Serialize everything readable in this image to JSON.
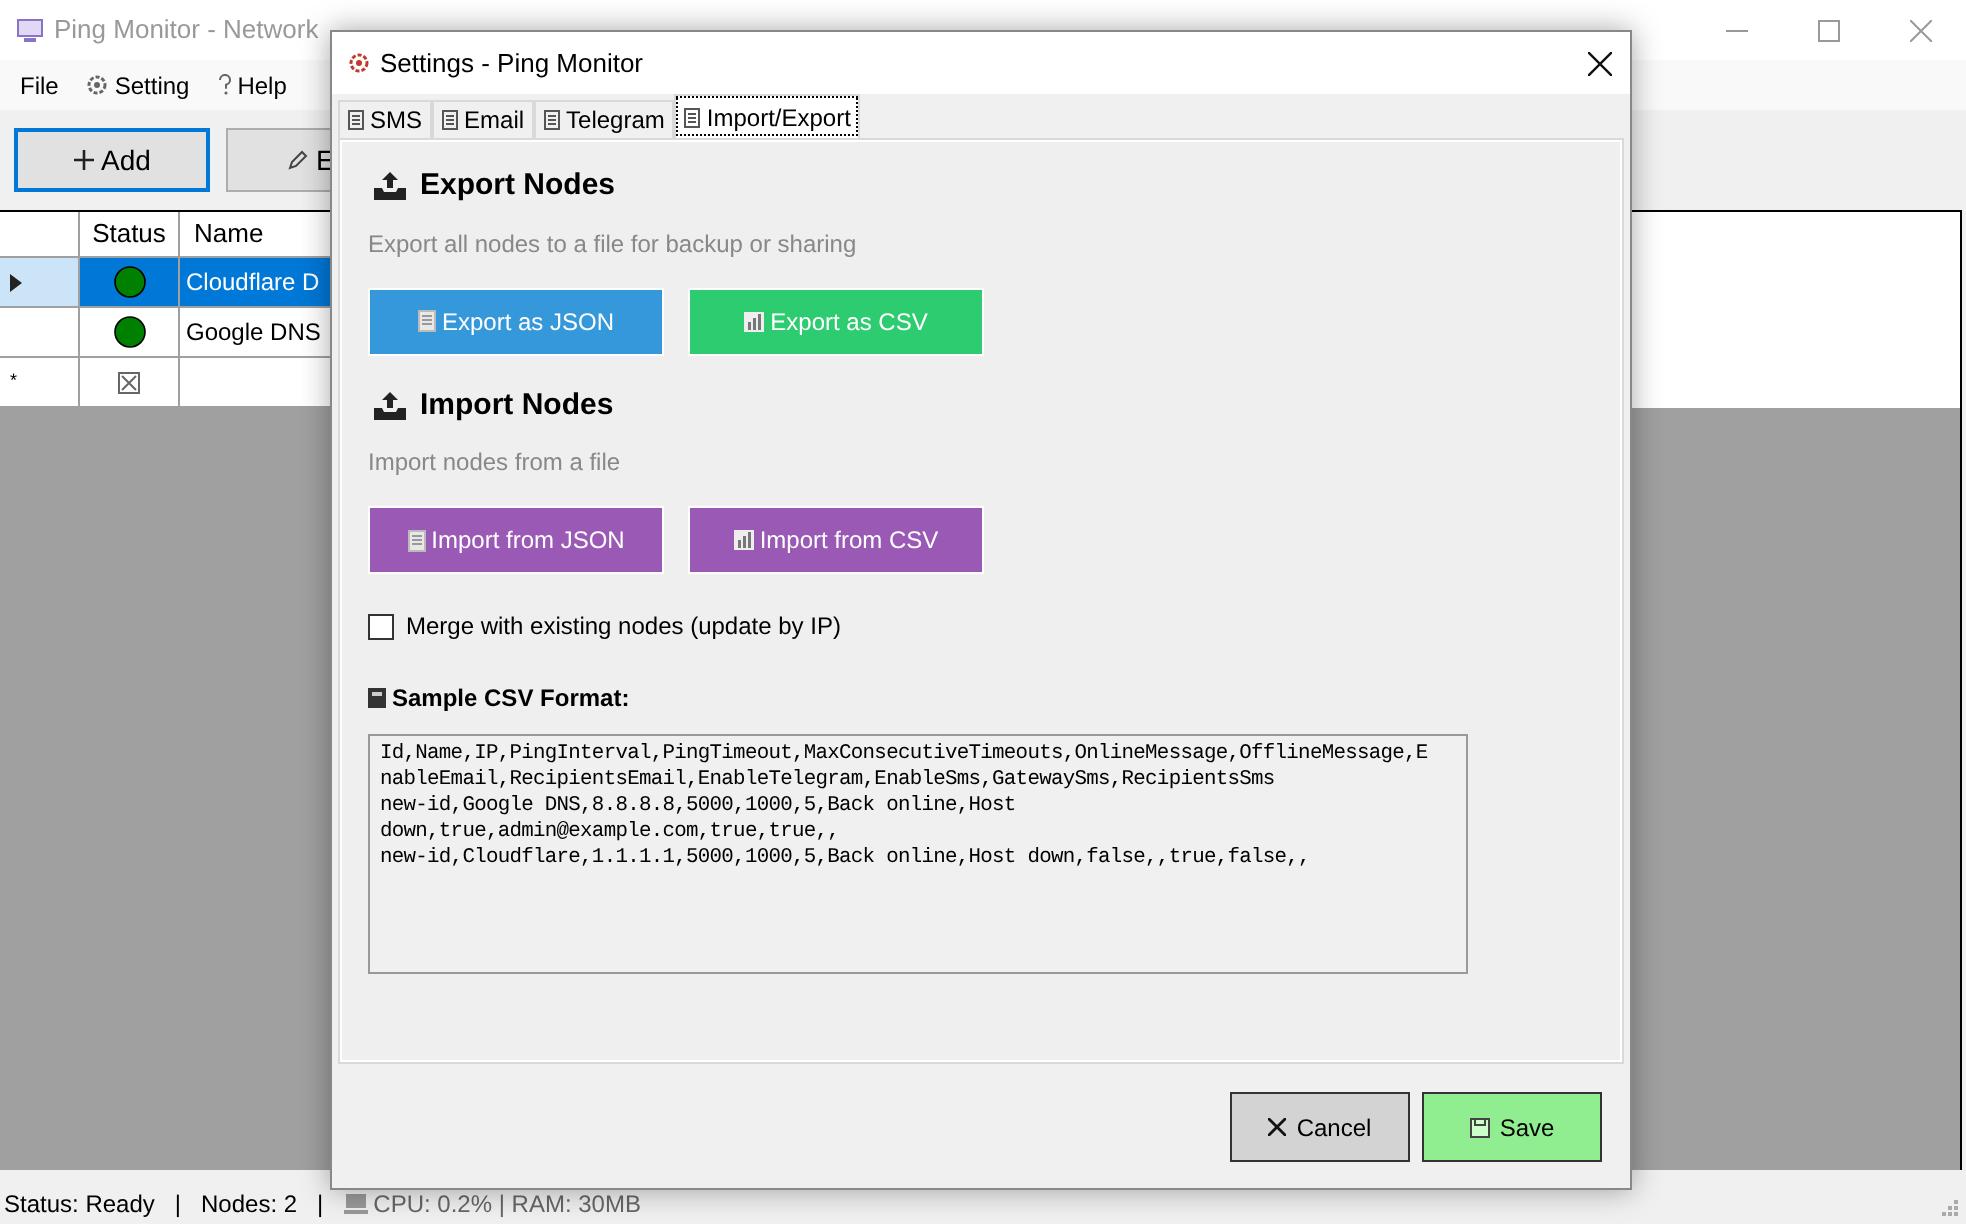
{
  "window": {
    "title": "Ping Monitor - Network"
  },
  "menu": [
    "File",
    "Setting",
    "Help"
  ],
  "toolbar": [
    {
      "label": "Add",
      "kind": "add",
      "focused": true
    },
    {
      "label": "E",
      "kind": "edit",
      "focused": false
    }
  ],
  "grid": {
    "columns": [
      "Status",
      "Name"
    ],
    "rows": [
      {
        "kind": "node",
        "name": "Cloudflare D",
        "color": "#008000",
        "selected": true
      },
      {
        "kind": "node",
        "name": "Google DNS",
        "color": "#008000",
        "selected": false
      },
      {
        "kind": "new_row",
        "marker": "*",
        "selected": false
      }
    ]
  },
  "status_bar": {
    "status": "Status: Ready",
    "separator_1": "|",
    "nodes": "Nodes: 2",
    "separator_2": "|",
    "resources": "CPU: 0.2% | RAM: 30MB"
  },
  "dialog": {
    "title": "Settings - Ping Monitor",
    "tabs": [
      {
        "label": "SMS",
        "selected": false
      },
      {
        "label": "Email",
        "selected": false
      },
      {
        "label": "Telegram",
        "selected": false
      },
      {
        "label": "Import/Export",
        "selected": true
      }
    ],
    "sections": [
      {
        "heading": "Export Nodes",
        "description": "Export all nodes to a file for backup or sharing",
        "buttons": [
          {
            "label": "Export as JSON",
            "kind": "json",
            "color": "#3498db"
          },
          {
            "label": "Export as CSV",
            "kind": "csv",
            "color": "#2ecc71"
          }
        ]
      },
      {
        "heading": "Import Nodes",
        "description": "Import nodes from a file",
        "buttons": [
          {
            "label": "Import from JSON",
            "kind": "json",
            "color": "#9b59b6"
          },
          {
            "label": "Import from CSV",
            "kind": "csv",
            "color": "#9b59b6"
          }
        ]
      }
    ],
    "merge": {
      "label": "Merge with existing nodes (update by IP)",
      "checked": false
    },
    "sample": {
      "label": "Sample CSV Format:",
      "lines": [
        "Id,Name,IP,PingInterval,PingTimeout,MaxConsecutiveTimeouts,OnlineMessage,OfflineMessage,E",
        "nableEmail,RecipientsEmail,EnableTelegram,EnableSms,GatewaySms,RecipientsSms",
        "new-id,Google DNS,8.8.8.8,5000,1000,5,Back online,Host",
        "down,true,admin@example.com,true,true,,",
        "new-id,Cloudflare,1.1.1.1,5000,1000,5,Back online,Host down,false,,true,false,,"
      ]
    },
    "buttons": [
      {
        "label": "Cancel",
        "kind": "cancel"
      },
      {
        "label": "Save",
        "kind": "save"
      }
    ]
  }
}
